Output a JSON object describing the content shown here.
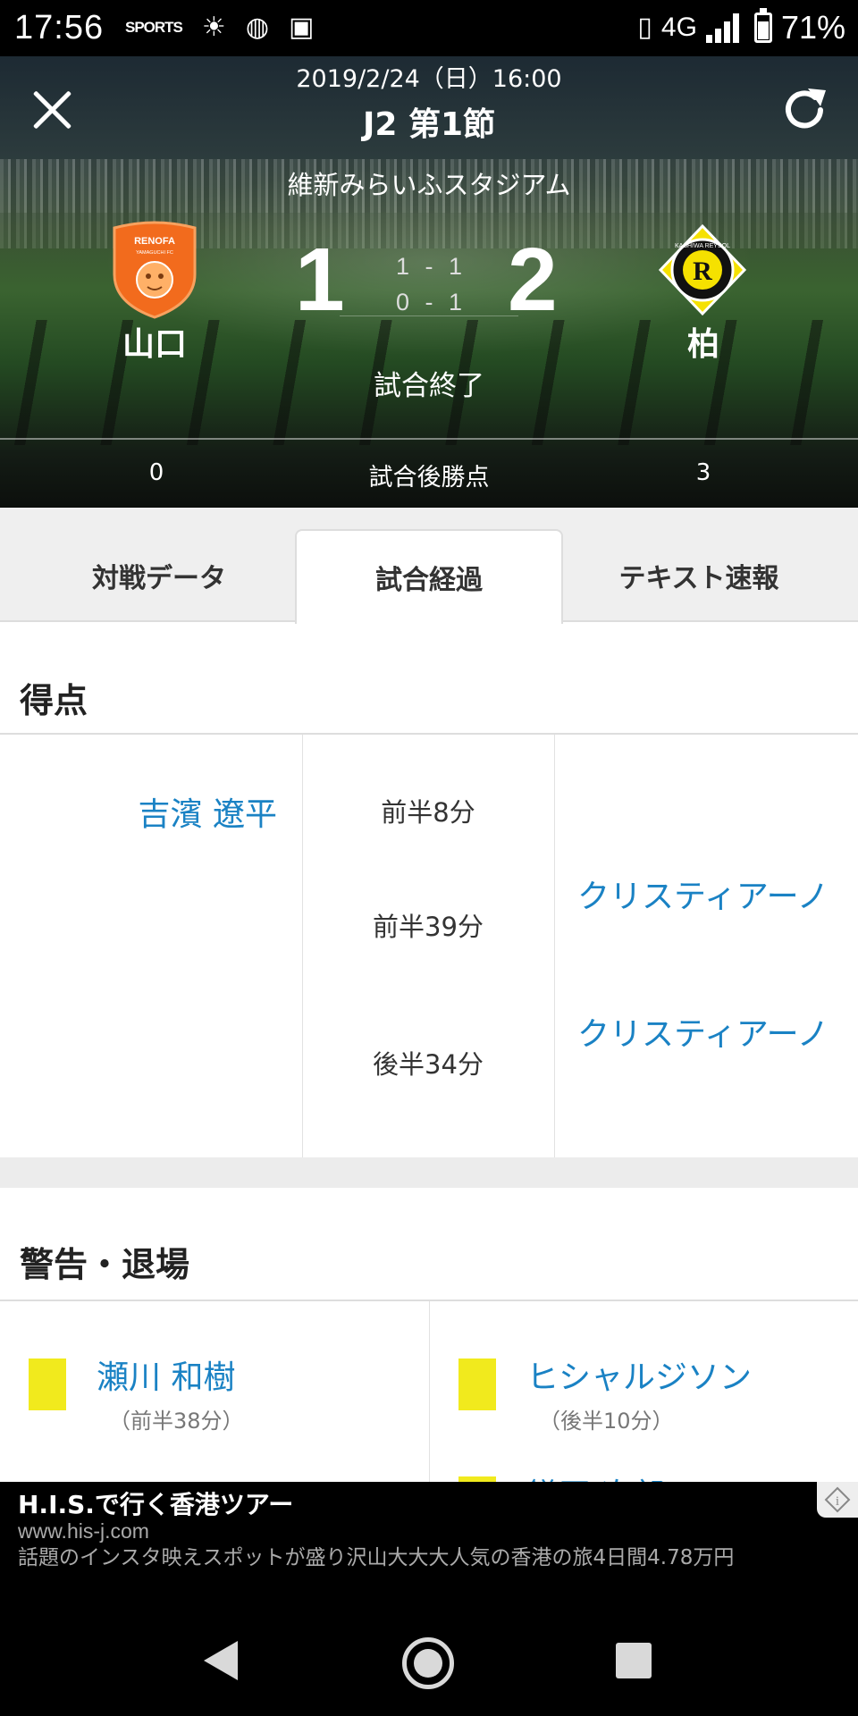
{
  "status_bar": {
    "time": "17:56",
    "sports_label": "SPORTS",
    "network": "4G",
    "battery": "71%",
    "icons": [
      "sports-navi-icon",
      "weather-icon",
      "globe-icon",
      "battery-saver-icon",
      "vibrate-icon",
      "signal-icon",
      "battery-icon"
    ]
  },
  "header": {
    "date": "2019/2/24（日）16:00",
    "round": "J2 第1節",
    "stadium": "維新みらいふスタジアム",
    "home_team": "山口",
    "away_team": "柏",
    "home_score": "1",
    "away_score": "2",
    "first_half": "1 - 1",
    "second_half": "0 - 1",
    "status": "試合終了",
    "points_label": "試合後勝点",
    "home_points": "0",
    "away_points": "3",
    "home_logo_text": "RENOFA",
    "home_logo_sub": "YAMAGUCHI FC",
    "away_logo_text": "KASHIWA REYSOL",
    "home_color": "#f26b1d",
    "away_color": "#f5e100"
  },
  "tabs": [
    {
      "label": "対戦データ",
      "active": false
    },
    {
      "label": "試合経過",
      "active": true
    },
    {
      "label": "テキスト速報",
      "active": false
    }
  ],
  "goals": {
    "title": "得点",
    "rows": [
      {
        "home": "吉濱 遼平",
        "time": "前半8分",
        "away": ""
      },
      {
        "home": "",
        "time": "前半39分",
        "away": "クリスティアーノ"
      },
      {
        "home": "",
        "time": "後半34分",
        "away": "クリスティアーノ"
      }
    ]
  },
  "cards": {
    "title": "警告・退場",
    "home": [
      {
        "player": "瀬川 和樹",
        "time": "（前半38分）"
      }
    ],
    "away": [
      {
        "player": "ヒシャルジソン",
        "time": "（後半10分）"
      },
      {
        "player": "鎌田 次郎",
        "time": ""
      }
    ]
  },
  "ad": {
    "title": "H.I.S.で行く香港ツアー",
    "url": "www.his-j.com",
    "description": "話題のインスタ映えスポットが盛り沢山大大大人気の香港の旅4日間4.78万円"
  },
  "colors": {
    "link": "#1a82c4",
    "yellow_card": "#f1ea1d"
  }
}
